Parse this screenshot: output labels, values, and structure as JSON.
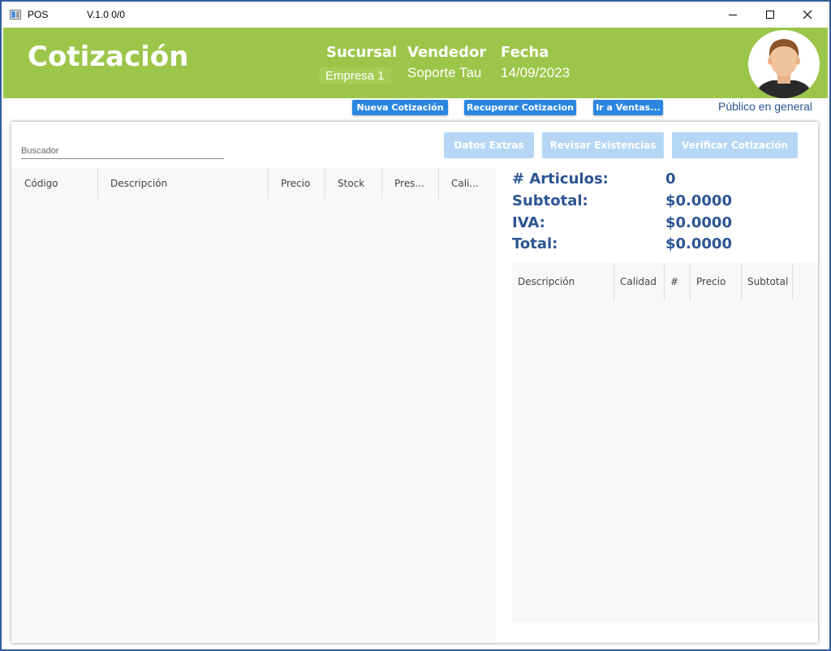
{
  "titlebar": {
    "app_name": "POS",
    "version": "V.1.0  0/0"
  },
  "header": {
    "title": "Cotización",
    "sucursal_label": "Sucursal",
    "sucursal_value": "Empresa 1",
    "vendedor_label": "Vendedor",
    "vendedor_value": "Soporte Tau",
    "fecha_label": "Fecha",
    "fecha_value": "14/09/2023"
  },
  "actions": {
    "nueva": "Nueva Cotización",
    "recuperar": "Recuperar Cotizacion",
    "ir_ventas": "Ir a Ventas...",
    "cliente": "Público en general"
  },
  "toolbar": {
    "search_placeholder": "Buscador",
    "datos_extras": "Datos Extras",
    "revisar": "Revisar Existencias",
    "verificar": "Verificar Cotización"
  },
  "products_grid": {
    "columns": [
      "Código",
      "Descripción",
      "Precio",
      "Stock",
      "Pres...",
      "Cali..."
    ]
  },
  "totals": {
    "articulos_label": "# Articulos:",
    "articulos_value": "0",
    "subtotal_label": "Subtotal:",
    "subtotal_value": "$0.0000",
    "iva_label": "IVA:",
    "iva_value": "$0.0000",
    "total_label": "Total:",
    "total_value": "$0.0000"
  },
  "quote_grid": {
    "columns": [
      "Descripción",
      "Calidad",
      "#",
      "Precio",
      "Subtotal"
    ]
  },
  "colors": {
    "header_green": "#9cc64a",
    "accent_blue": "#2b86e0",
    "text_blue": "#2c5592",
    "disabled_blue": "#b5d7f5"
  },
  "icons": [
    "app-icon",
    "minimize-icon",
    "maximize-icon",
    "close-icon",
    "user-avatar"
  ]
}
